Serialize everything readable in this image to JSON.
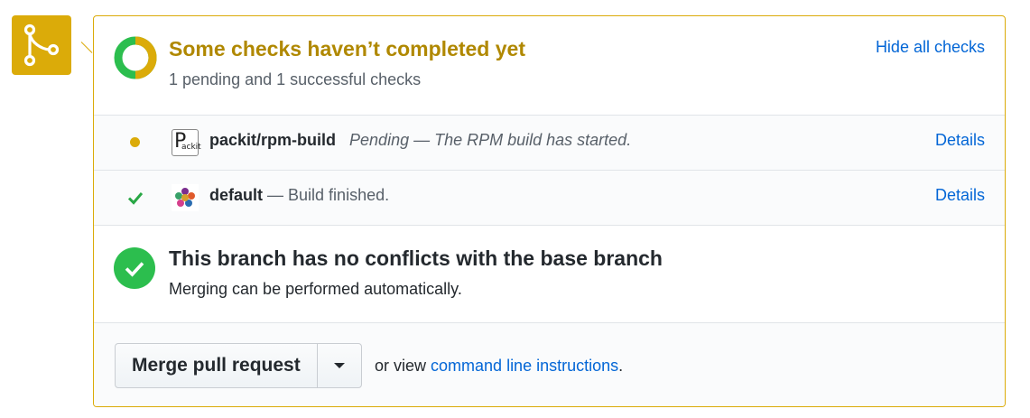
{
  "colors": {
    "pending": "#dbab09",
    "pending_text": "#b08800",
    "success": "#2cbe4e",
    "link": "#0366d6"
  },
  "status_header": {
    "title": "Some checks haven’t completed yet",
    "subtitle": "1 pending and 1 successful checks",
    "hide_link": "Hide all checks",
    "icon": "donut-progress-icon"
  },
  "checks": [
    {
      "status_icon": "pending-dot-icon",
      "avatar_icon": "packit-logo-icon",
      "avatar_text_big": "P",
      "avatar_text_small": "ackit",
      "name": "packit/rpm-build",
      "description": "Pending — The RPM build has started.",
      "details_label": "Details"
    },
    {
      "status_icon": "check-icon",
      "avatar_icon": "default-app-avatar-icon",
      "name": "default",
      "description": "— Build finished.",
      "details_label": "Details"
    }
  ],
  "branch": {
    "icon": "check-circle-icon",
    "title": "This branch has no conflicts with the base branch",
    "subtitle": "Merging can be performed automatically."
  },
  "merge": {
    "button_label": "Merge pull request",
    "dropdown_icon": "caret-down-icon",
    "note_prefix": "or view",
    "note_link": "command line instructions",
    "note_suffix": "."
  },
  "side_icon": "git-merge-icon"
}
